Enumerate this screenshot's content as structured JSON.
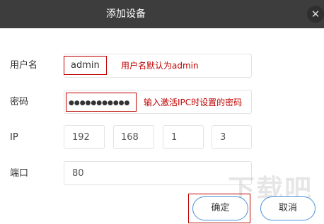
{
  "dialog": {
    "title": "添加设备",
    "close_glyph": "✕"
  },
  "form": {
    "username": {
      "label": "用户名",
      "value": "admin",
      "annotation": "用户名默认为admin"
    },
    "password": {
      "label": "密码",
      "value": "●●●●●●●●●●●",
      "annotation": "输入激活IPC时设置的密码"
    },
    "ip": {
      "label": "IP",
      "octets": [
        "192",
        "168",
        "1",
        "3"
      ]
    },
    "port": {
      "label": "端口",
      "value": "80"
    }
  },
  "buttons": {
    "confirm": "确定",
    "cancel": "取消"
  },
  "colors": {
    "titlebar": "#3d3d3d",
    "annotation_red": "#c00000",
    "button_border": "#4a90d9"
  }
}
